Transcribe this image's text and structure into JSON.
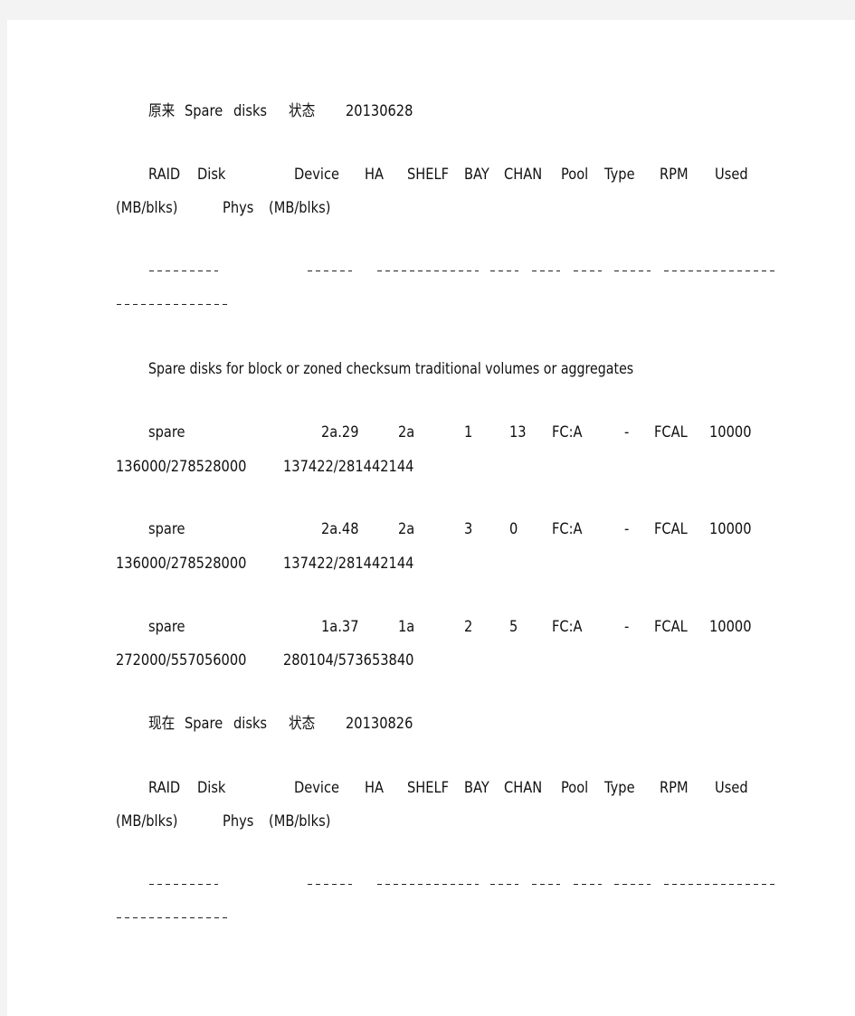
{
  "sections": [
    {
      "title": {
        "label": "原来",
        "words": [
          "Spare",
          "disks",
          "状态"
        ],
        "date": "20130628"
      },
      "header": {
        "cols_line1": [
          "RAID",
          "Disk",
          "Device",
          "HA",
          "SHELF",
          "BAY",
          "CHAN",
          "Pool",
          "Type",
          "RPM",
          "Used"
        ],
        "cols_line2": [
          "(MB/blks)",
          "Phys",
          "(MB/blks)"
        ]
      },
      "separator": {
        "line1_dash_counts": [
          9,
          6,
          13,
          4,
          4,
          4,
          5,
          14
        ],
        "line2_dash_counts": [
          14
        ]
      },
      "group_heading": "Spare disks for block or zoned checksum traditional volumes or aggregates",
      "rows": [
        {
          "raid": "spare",
          "device": "2a.29",
          "ha": "2a",
          "shelf": "1",
          "bay": "13",
          "chan": "FC:A",
          "pool": "-",
          "type": "FCAL",
          "rpm": "10000",
          "used": "136000/278528000",
          "phys": "137422/281442144"
        },
        {
          "raid": "spare",
          "device": "2a.48",
          "ha": "2a",
          "shelf": "3",
          "bay": "0",
          "chan": "FC:A",
          "pool": "-",
          "type": "FCAL",
          "rpm": "10000",
          "used": "136000/278528000",
          "phys": "137422/281442144"
        },
        {
          "raid": "spare",
          "device": "1a.37",
          "ha": "1a",
          "shelf": "2",
          "bay": "5",
          "chan": "FC:A",
          "pool": "-",
          "type": "FCAL",
          "rpm": "10000",
          "used": "272000/557056000",
          "phys": "280104/573653840"
        }
      ]
    },
    {
      "title": {
        "label": "现在",
        "words": [
          "Spare",
          "disks",
          "状态"
        ],
        "date": "20130826"
      },
      "header": {
        "cols_line1": [
          "RAID",
          "Disk",
          "Device",
          "HA",
          "SHELF",
          "BAY",
          "CHAN",
          "Pool",
          "Type",
          "RPM",
          "Used"
        ],
        "cols_line2": [
          "(MB/blks)",
          "Phys",
          "(MB/blks)"
        ]
      },
      "separator": {
        "line1_dash_counts": [
          9,
          6,
          13,
          4,
          4,
          4,
          5,
          14
        ],
        "line2_dash_counts": [
          14
        ]
      }
    }
  ]
}
